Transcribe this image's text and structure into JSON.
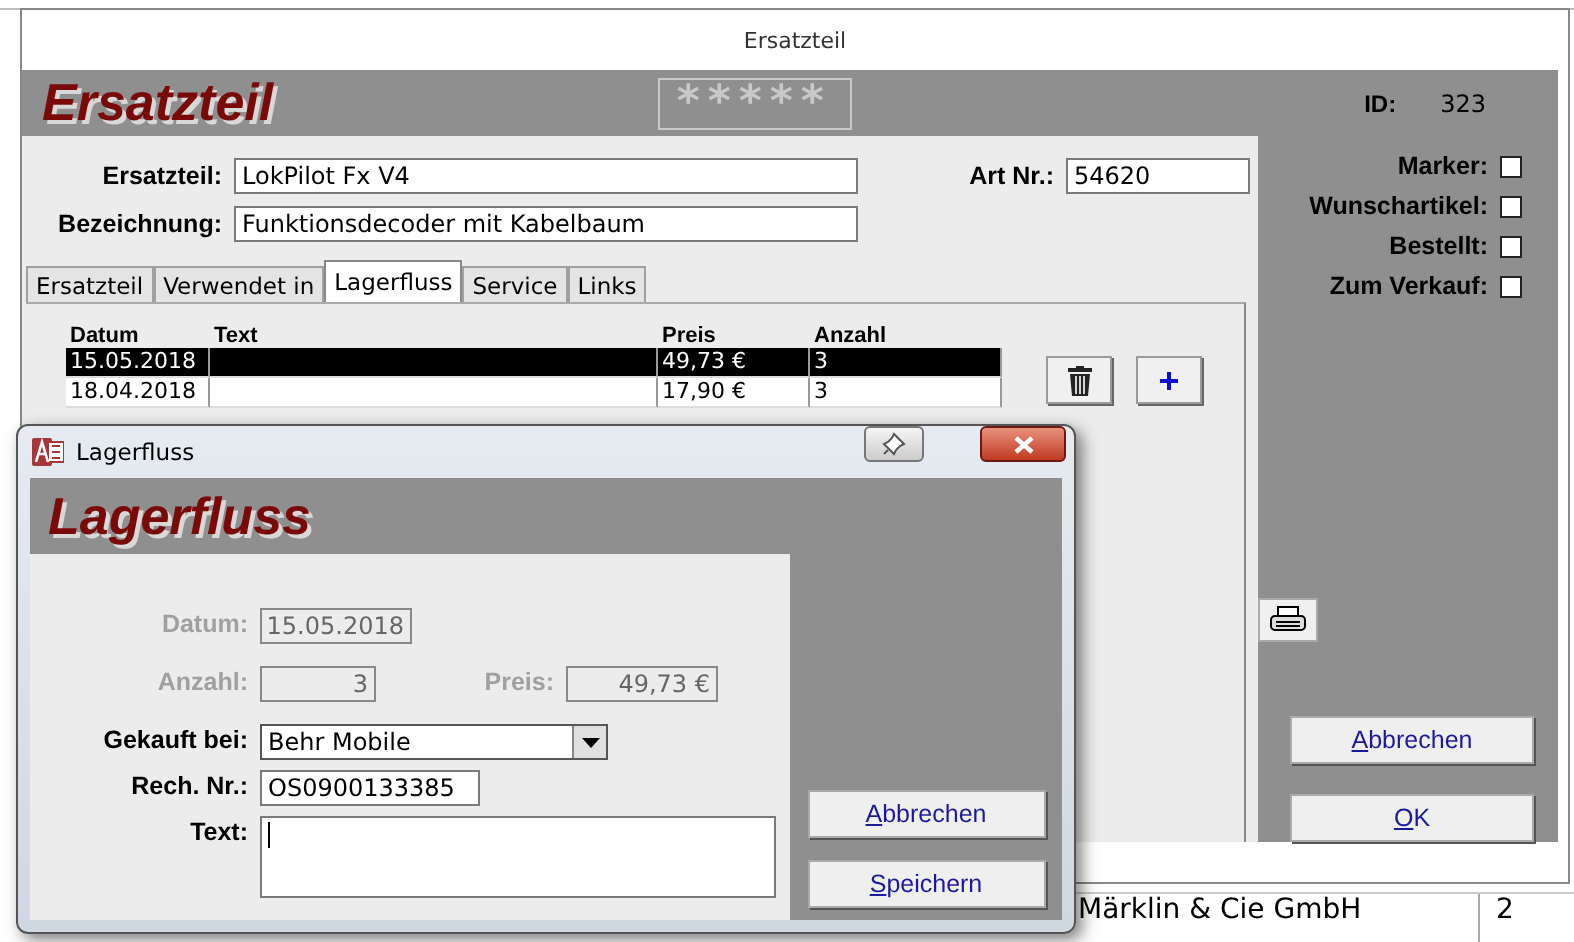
{
  "window": {
    "title": "Ersatzteil"
  },
  "header": {
    "title": "Ersatzteil",
    "rating": "*****",
    "id_label": "ID:",
    "id_value": "323"
  },
  "fields": [
    {
      "label": "Ersatzteil:",
      "value": "LokPilot Fx V4"
    },
    {
      "label": "Bezeichnung:",
      "value": "Funktionsdecoder mit Kabelbaum"
    }
  ],
  "art_nr": {
    "label": "Art Nr.:",
    "value": "54620"
  },
  "flags": [
    {
      "label": "Marker:",
      "checked": false
    },
    {
      "label": "Wunschartikel:",
      "checked": false
    },
    {
      "label": "Bestellt:",
      "checked": false
    },
    {
      "label": "Zum Verkauf:",
      "checked": false
    }
  ],
  "tabs": [
    {
      "label": "Ersatzteil",
      "selected": false
    },
    {
      "label": "Verwendet in",
      "selected": false
    },
    {
      "label": "Lagerfluss",
      "selected": true
    },
    {
      "label": "Service",
      "selected": false
    },
    {
      "label": "Links",
      "selected": false
    }
  ],
  "table": {
    "columns": [
      "Datum",
      "Text",
      "Preis",
      "Anzahl"
    ],
    "rows": [
      {
        "datum": "15.05.2018",
        "preis": "49,73 €",
        "anzahl": "3",
        "selected": true
      },
      {
        "datum": "18.04.2018",
        "preis": "17,90 €",
        "anzahl": "3",
        "selected": false
      }
    ]
  },
  "buttons": [
    "Abbrechen",
    "OK"
  ],
  "dialog": {
    "title": "Lagerfluss",
    "heading": "Lagerfluss",
    "rows": [
      [
        {
          "kind": "text",
          "label": "Datum:",
          "value": "15.05.2018",
          "disabled": true
        }
      ],
      [
        {
          "kind": "text",
          "label": "Anzahl:",
          "value": "3",
          "disabled": true
        },
        {
          "kind": "text",
          "label": "Preis:",
          "value": "49,73 €",
          "disabled": true
        }
      ],
      [
        {
          "kind": "combo",
          "label": "Gekauft bei:",
          "value": "Behr Mobile",
          "disabled": false
        }
      ],
      [
        {
          "kind": "text",
          "label": "Rech. Nr.:",
          "value": "OS0900133385",
          "disabled": false
        }
      ],
      [
        {
          "kind": "memo",
          "label": "Text:",
          "disabled": false
        }
      ]
    ],
    "buttons": [
      "Abbrechen",
      "Speichern"
    ]
  },
  "background_rows": [
    {
      "name": "Märklin & Cie GmbH",
      "count": "2"
    }
  ]
}
